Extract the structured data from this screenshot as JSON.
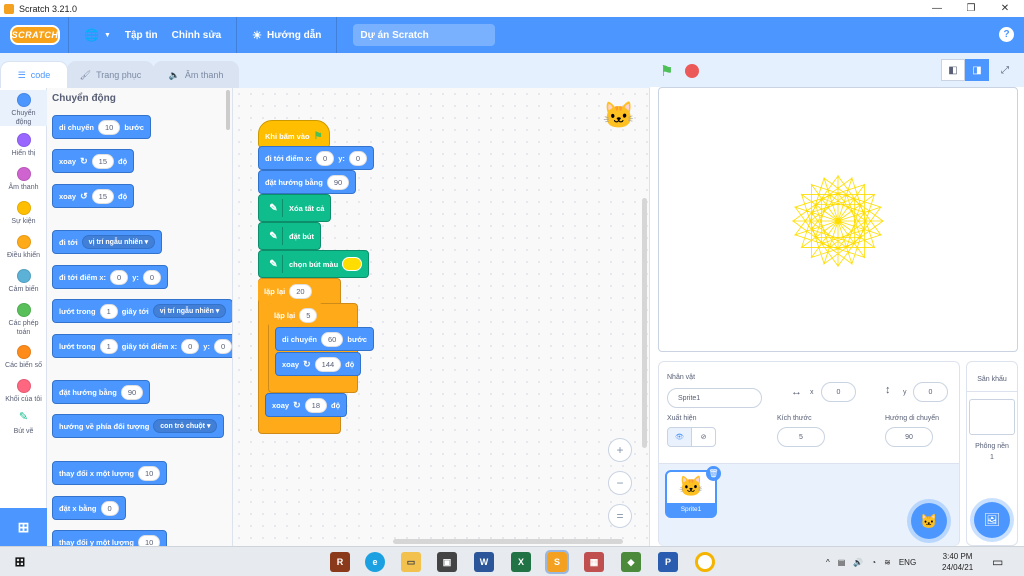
{
  "window": {
    "title": "Scratch 3.21.0",
    "minimize": "—",
    "maximize": "❐",
    "close": "✕"
  },
  "menubar": {
    "logo": "SCRATCH",
    "globe": "🌐",
    "file": "Tập tin",
    "edit": "Chỉnh sửa",
    "tutorials": "Hướng dẫn",
    "project_name": "Dự án Scratch",
    "help": "?"
  },
  "tabs": {
    "code": "code",
    "costumes": "Trang phục",
    "sounds": "Âm thanh"
  },
  "categories": [
    {
      "label1": "Chuyển",
      "label2": "động",
      "color": "#4c97ff"
    },
    {
      "label1": "Hiển thị",
      "label2": "",
      "color": "#9966ff"
    },
    {
      "label1": "Âm thanh",
      "label2": "",
      "color": "#cf63cf"
    },
    {
      "label1": "Sự kiện",
      "label2": "",
      "color": "#ffbf00"
    },
    {
      "label1": "Điều khiển",
      "label2": "",
      "color": "#ffab19"
    },
    {
      "label1": "Cảm biến",
      "label2": "",
      "color": "#5cb1d6"
    },
    {
      "label1": "Các phép",
      "label2": "toán",
      "color": "#59c059"
    },
    {
      "label1": "Các biến số",
      "label2": "",
      "color": "#ff8c1a"
    },
    {
      "label1": "Khối của tôi",
      "label2": "",
      "color": "#ff6680"
    },
    {
      "label1": "Bút vẽ",
      "label2": "",
      "color": "#0fbd8c"
    }
  ],
  "palette": {
    "title": "Chuyển động",
    "move": "di chuyển",
    "move_steps": "10",
    "steps": "bước",
    "turn": "xoay",
    "turn_deg": "15",
    "deg": "độ",
    "goto": "đi tới",
    "goto_target": "vị trí ngẫu nhiên",
    "gotoxy": "đi tới điểm x:",
    "x0": "0",
    "y_label": "y:",
    "y0": "0",
    "glide": "lướt trong",
    "glide_secs": "1",
    "secs_to": "giây tới",
    "glide_target": "vị trí ngẫu nhiên",
    "glide_xy": "giây tới điểm x:",
    "point_dir": "đặt hướng bằng",
    "dir_val": "90",
    "point_towards": "hướng về phía đối tượng",
    "towards_target": "con trỏ chuột",
    "change_x": "thay đổi x một lượng",
    "change_x_val": "10",
    "set_x": "đặt x bằng",
    "set_x_val": "0",
    "change_y": "thay đổi y một lượng",
    "change_y_val": "10"
  },
  "script": {
    "hat": "Khi bấm vào",
    "gotoxy": "đi tới điểm x:",
    "x": "0",
    "y_label": "y:",
    "y": "0",
    "point": "đặt hướng bằng",
    "point_val": "90",
    "clear": "Xóa tất cả",
    "pendown": "đặt bút",
    "setcolor": "chọn bút màu",
    "pen_color": "#ffdd00",
    "repeat_outer": "lặp lại",
    "outer_n": "20",
    "repeat_inner": "lặp lại",
    "inner_n": "5",
    "move": "di chuyển",
    "move_val": "60",
    "steps": "bước",
    "turn_inner": "xoay",
    "turn_inner_val": "144",
    "deg": "độ",
    "turn_outer": "xoay",
    "turn_outer_val": "18"
  },
  "zoom": {
    "in": "+",
    "out": "−",
    "reset": "="
  },
  "sprite_info": {
    "label_sprite": "Nhân vật",
    "sprite_name": "Sprite1",
    "x_label": "x",
    "x": "0",
    "y_label": "y",
    "y": "0",
    "label_show": "Xuất hiện",
    "label_size": "Kích thước",
    "size": "5",
    "label_direction": "Hướng di chuyển",
    "direction": "90"
  },
  "sprite_list": {
    "sprite1": "Sprite1"
  },
  "stage_panel": {
    "title": "Sân khấu",
    "backdrops_label": "Phông nền",
    "backdrops_count": "1"
  },
  "taskbar": {
    "ime": "ENG",
    "time": "3:40 PM",
    "date": "24/04/21"
  },
  "colors": {
    "accent": "#4c97ff",
    "star": "#ffdd00"
  }
}
